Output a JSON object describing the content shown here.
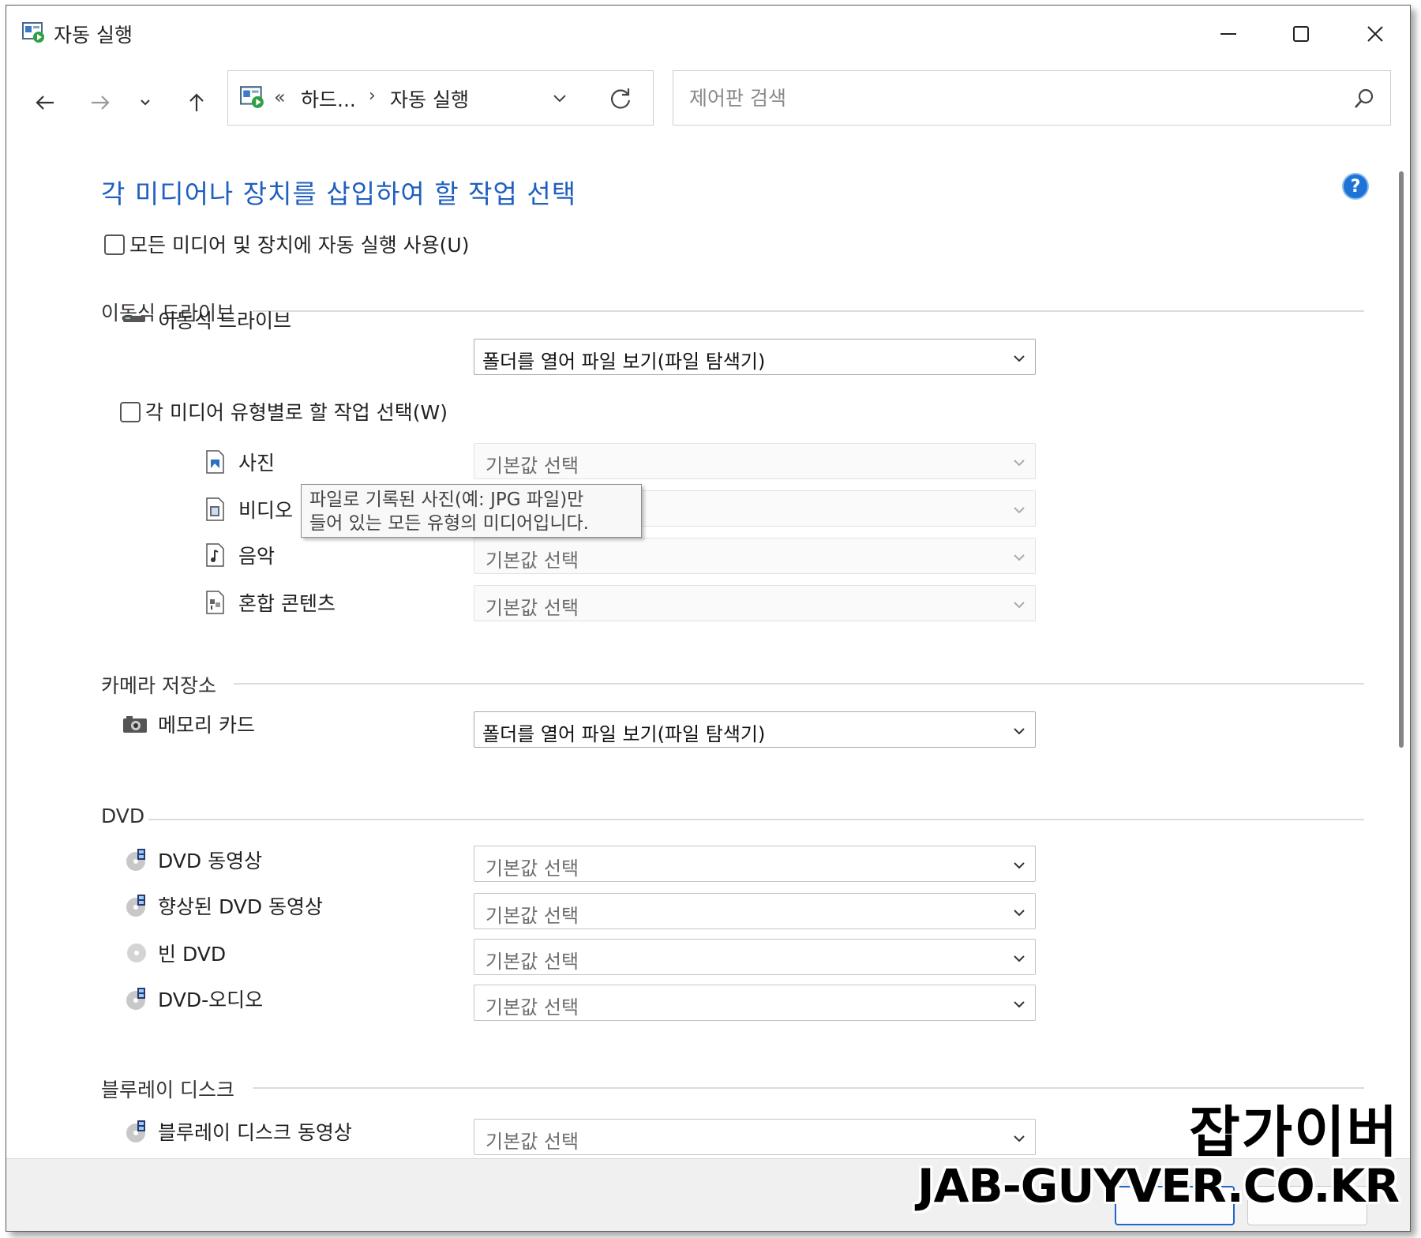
{
  "window": {
    "title": "자동 실행",
    "icon": "autoplay-icon"
  },
  "titlebar_buttons": {
    "minimize": "minimize-icon",
    "maximize": "maximize-icon",
    "close": "close-icon"
  },
  "nav": {
    "back": "arrow-left-icon",
    "forward": "arrow-right-icon",
    "recent": "chevron-down-icon",
    "up": "arrow-up-icon",
    "address": {
      "overflow": "«",
      "crumb1": "하드...",
      "separator": "›",
      "crumb2": "자동 실행"
    },
    "search": {
      "placeholder": "제어판 검색"
    }
  },
  "heading": "각 미디어나 장치를 삽입하여 할 작업 선택",
  "use_autoplay_label": "모든 미디어 및 장치에 자동 실행 사용(U)",
  "removable": {
    "section": "이동식 드라이브",
    "drive_label": "이동식 드라이브",
    "drive_value": "폴더를 열어 파일 보기(파일 탐색기)",
    "per_type_label": "각 미디어 유형별로 할 작업 선택(W)",
    "items": [
      {
        "label": "사진",
        "value": "기본값 선택",
        "icon": "picture-icon"
      },
      {
        "label": "비디오",
        "value": "",
        "icon": "video-icon"
      },
      {
        "label": "음악",
        "value": "기본값 선택",
        "icon": "music-icon"
      },
      {
        "label": "혼합 콘텐츠",
        "value": "기본값 선택",
        "icon": "mixed-content-icon"
      }
    ]
  },
  "tooltip": {
    "line1": "파일로 기록된 사진(예: JPG 파일)만",
    "line2": "들어 있는 모든 유형의 미디어입니다."
  },
  "camera": {
    "section": "카메라 저장소",
    "label": "메모리 카드",
    "value": "폴더를 열어 파일 보기(파일 탐색기)"
  },
  "dvd": {
    "section": "DVD",
    "items": [
      {
        "label": "DVD 동영상",
        "value": "기본값 선택"
      },
      {
        "label": "향상된 DVD 동영상",
        "value": "기본값 선택"
      },
      {
        "label": "빈 DVD",
        "value": "기본값 선택"
      },
      {
        "label": "DVD-오디오",
        "value": "기본값 선택"
      }
    ]
  },
  "bluray": {
    "section": "블루레이 디스크",
    "items": [
      {
        "label": "블루레이 디스크 동영상",
        "value": "기본값 선택"
      }
    ]
  },
  "watermark": {
    "line1": "잡가이버",
    "line2": "JAB-GUYVER.CO.KR"
  },
  "colors": {
    "heading": "#1f5fbf",
    "help": "#1e73d6",
    "primary_button_border": "#1f66c7"
  }
}
